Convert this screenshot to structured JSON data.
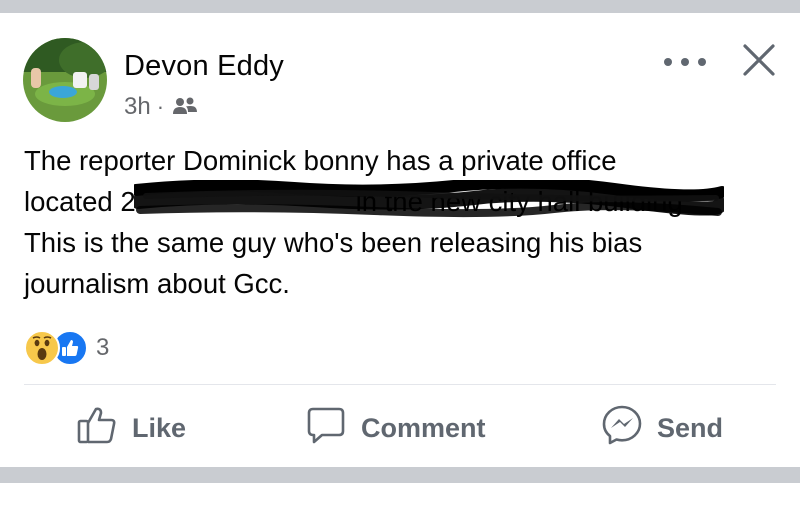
{
  "post": {
    "author": "Devon Eddy",
    "time": "3h",
    "separator": "·",
    "audience_icon": "group-icon",
    "text": "The reporter Dominick bonny has a private office\nlocated 2        in the new city hall building\nThis is the same guy who's been releasing his bias\njournalism about Gcc.",
    "reactions": {
      "icons": [
        "wow-reaction-icon",
        "like-reaction-icon"
      ],
      "count": "3"
    }
  },
  "actions": {
    "like_label": "Like",
    "comment_label": "Comment",
    "send_label": "Send"
  },
  "colors": {
    "text": "#050505",
    "secondary": "#65676b",
    "like_blue": "#1877f2",
    "separator": "#c9ccd1"
  }
}
